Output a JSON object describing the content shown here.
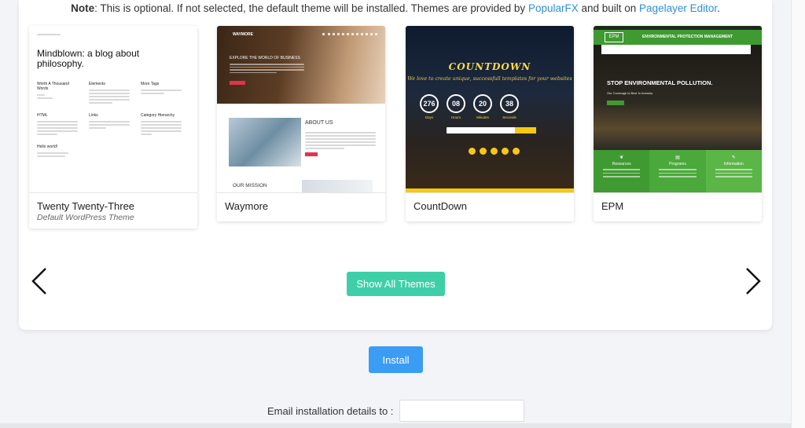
{
  "note": {
    "bold": "Note",
    "text1": ": This is optional. If not selected, the default theme will be installed. Themes are provided by ",
    "link1": "PopularFX",
    "text2": " and built on ",
    "link2": "Pagelayer Editor",
    "text3": "."
  },
  "themes": [
    {
      "name": "Twenty Twenty-Three",
      "subtitle": "Default WordPress Theme",
      "preview": {
        "heading": "Mindblown: a blog about philosophy.",
        "col1": "Worth A Thousand Words",
        "col2": "Elements",
        "col3": "More Tags",
        "col4": "HTML",
        "col5": "Links",
        "col6": "Category Hierarchy",
        "post": "Hello world!"
      }
    },
    {
      "name": "Waymore",
      "subtitle": "",
      "preview": {
        "logo": "WAYMORE",
        "hero": "EXPLORE THE WORLD OF BUSINESS",
        "about": "ABOUT US",
        "mission": "OUR MISSION"
      }
    },
    {
      "name": "CountDown",
      "subtitle": "",
      "preview": {
        "title": "COUNTDOWN",
        "tagline": "We love to create unique, successfull templates for your websites",
        "days": "276",
        "hours": "08",
        "minutes": "20",
        "seconds": "38",
        "days_label": "Days",
        "hours_label": "Hours",
        "minutes_label": "Minutes",
        "seconds_label": "Seconds"
      }
    },
    {
      "name": "EPM",
      "subtitle": "",
      "preview": {
        "logo": "EPM",
        "title": "ENVIRONMENTAL PROTECTION MANAGEMENT",
        "hero": "STOP ENVIRONMENTAL POLLUTION.",
        "hero_sub": "Our Coverage Is Best In Industry",
        "col1": "Resources",
        "col2": "Programs",
        "col3": "Information"
      }
    }
  ],
  "buttons": {
    "show_all": "Show All Themes",
    "install": "Install"
  },
  "email": {
    "label": "Email installation details to :",
    "value": ""
  },
  "colors": {
    "show_all_bg": "#3ecfa8",
    "install_bg": "#3b9cf4",
    "link": "#2d8fd5"
  }
}
